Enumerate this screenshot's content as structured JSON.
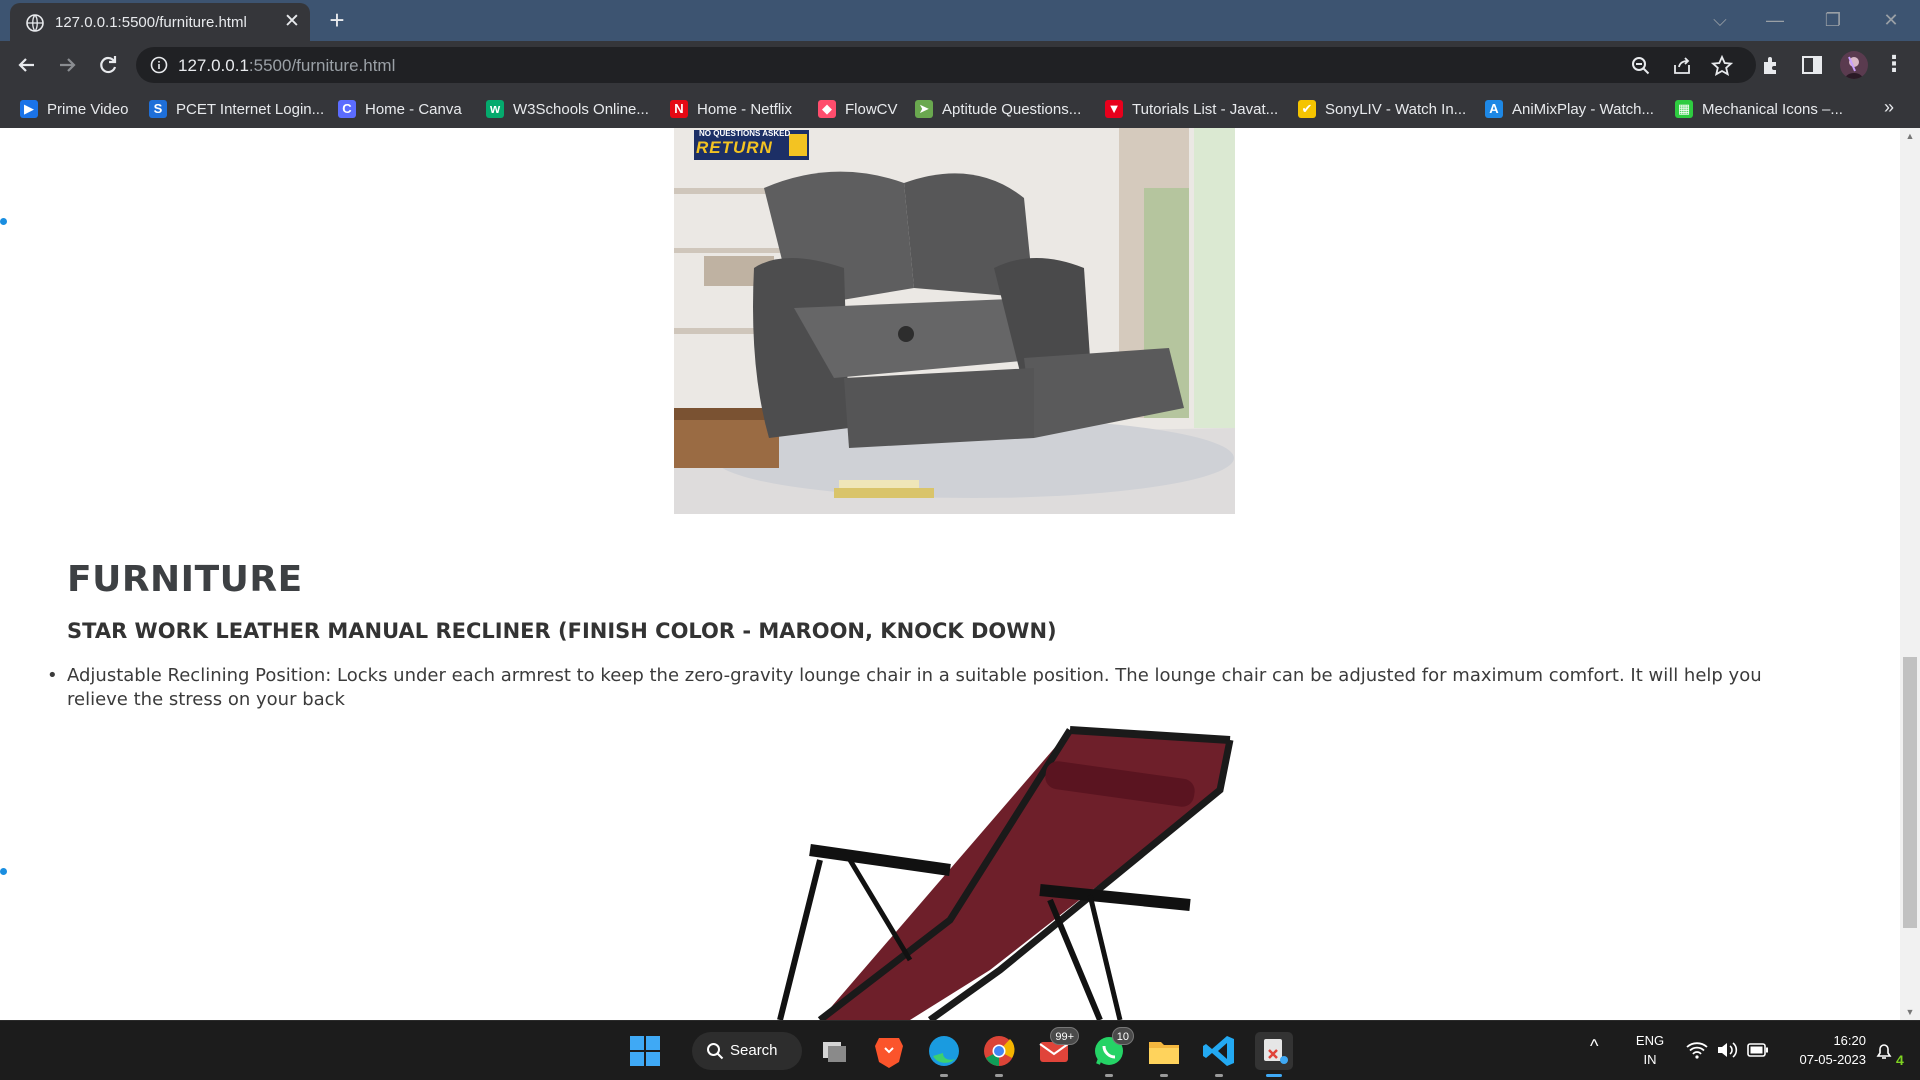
{
  "browser": {
    "tab": {
      "title": "127.0.0.1:5500/furniture.html",
      "close": "✕"
    },
    "new_tab": "+",
    "window_controls": {
      "tabsearch": "⌵",
      "minimize": "—",
      "restore": "❐",
      "close": "✕"
    },
    "url": {
      "host": "127.0.0.1",
      "path": ":5500/furniture.html"
    },
    "bookmarks": [
      {
        "label": "Prime Video",
        "icon": "prime-video-icon",
        "color": "#1a73e8",
        "glyph": "▶"
      },
      {
        "label": "PCET Internet Login...",
        "icon": "pcet-icon",
        "color": "#1e6fd9",
        "glyph": "S"
      },
      {
        "label": "Home - Canva",
        "icon": "canva-icon",
        "color": "#5b6cff",
        "glyph": "C"
      },
      {
        "label": "W3Schools Online...",
        "icon": "w3schools-icon",
        "color": "#04aa6d",
        "glyph": "w"
      },
      {
        "label": "Home - Netflix",
        "icon": "netflix-icon",
        "color": "#e50914",
        "glyph": "N"
      },
      {
        "label": "FlowCV",
        "icon": "flowcv-icon",
        "color": "#ff4d6d",
        "glyph": "◆"
      },
      {
        "label": "Aptitude Questions...",
        "icon": "aptitude-icon",
        "color": "#6aa84f",
        "glyph": "➤"
      },
      {
        "label": "Tutorials List - Javat...",
        "icon": "javatpoint-icon",
        "color": "#e8001c",
        "glyph": "▼"
      },
      {
        "label": "SonyLIV - Watch In...",
        "icon": "sonyliv-icon",
        "color": "#f5c400",
        "glyph": "✔"
      },
      {
        "label": "AniMixPlay - Watch...",
        "icon": "animixplay-icon",
        "color": "#1e88e5",
        "glyph": "A"
      },
      {
        "label": "Mechanical Icons –...",
        "icon": "mechanical-icons-icon",
        "color": "#2ecc40",
        "glyph": "▦"
      }
    ],
    "bookmarks_more": "»"
  },
  "page": {
    "image1": {
      "badge_top": "NO QUESTIONS ASKED",
      "badge_main": "RETURN"
    },
    "title": "FURNITURE",
    "product_title": "STAR WORK LEATHER MANUAL RECLINER (FINISH COLOR - MAROON, KNOCK DOWN)",
    "features": [
      "Adjustable Reclining Position: Locks under each armrest to keep the zero-gravity lounge chair in a suitable position. The lounge chair can be adjusted for maximum comfort. It will help you relieve the stress on your back"
    ]
  },
  "scrollbar": {
    "up": "▲",
    "down": "▼",
    "position_fraction": 0.6
  },
  "taskbar": {
    "search_label": "Search",
    "mail_badge": "99+",
    "whatsapp_badge": "10",
    "language": "ENG",
    "region": "IN",
    "time": "16:20",
    "date": "07-05-2023",
    "notification_count": "4",
    "tray_chevron": "^"
  },
  "colors": {
    "tabstrip": "#3d5471",
    "chrome": "#35363a",
    "link_dot": "#1a8ee0",
    "taskbar": "#1c1c1c"
  }
}
